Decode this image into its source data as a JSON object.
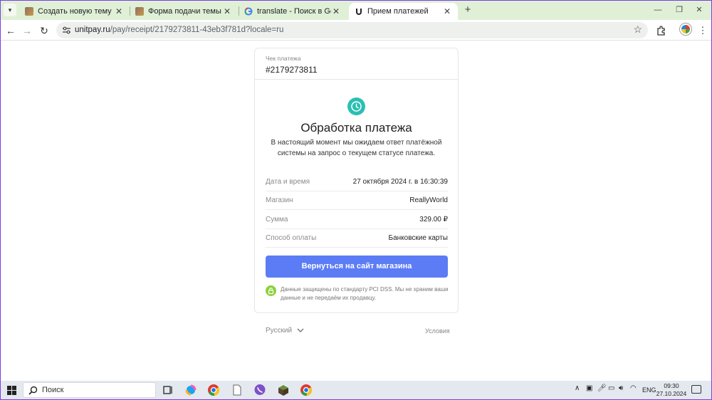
{
  "tabs": [
    {
      "title": "Создать новую тему - ReallyW",
      "active": false
    },
    {
      "title": "Форма подачи темы о найден",
      "active": false
    },
    {
      "title": "translate - Поиск в Google",
      "active": false
    },
    {
      "title": "Прием платежей",
      "active": true
    }
  ],
  "toolbar": {
    "url_host": "unitpay.ru",
    "url_path": "/pay/receipt/2179273811-43eb3f781d?locale=ru"
  },
  "receipt": {
    "label": "Чек платежа",
    "number": "#2179273811",
    "status_title": "Обработка платежа",
    "status_text": "В настоящий момент мы ожидаем ответ платёжной системы на запрос о текущем статусе платежа.",
    "rows": [
      {
        "key": "Дата и время",
        "value": "27 октября 2024 г. в 16:30:39"
      },
      {
        "key": "Магазин",
        "value": "ReallyWorld"
      },
      {
        "key": "Сумма",
        "value": "329.00 ₽"
      },
      {
        "key": "Способ оплаты",
        "value": "Банковские карты"
      }
    ],
    "return_button": "Вернуться на сайт магазина",
    "secure_text": "Данные защищены по стандарту PCI DSS. Мы не храним ваши данные и не передаём их продавцу."
  },
  "footer": {
    "language": "Русский",
    "terms": "Условия"
  },
  "taskbar": {
    "search_placeholder": "Поиск",
    "language": "ENG",
    "time": "09:30",
    "date": "27.10.2024"
  },
  "colors": {
    "accent": "#5b7cf5",
    "status": "#2bbfb3",
    "secure": "#8bd13a",
    "tabstrip": "#dff0d7",
    "window_border": "#7b3fe4"
  },
  "icons": [
    "clock-icon",
    "lock-icon",
    "chevron-down-icon",
    "star-icon",
    "extensions-icon",
    "windows-start-icon",
    "search-icon"
  ]
}
